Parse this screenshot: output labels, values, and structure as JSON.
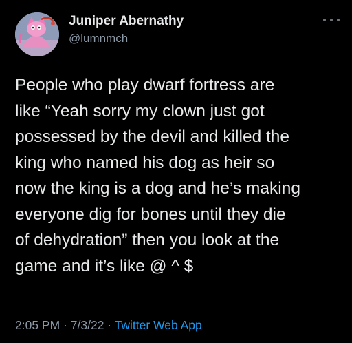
{
  "author": {
    "display_name": "Juniper Abernathy",
    "handle": "@lumnmch",
    "avatar_icon": "pink-cartoon-cat-avatar"
  },
  "more_icon": "more-horizontal-icon",
  "tweet": {
    "lines": [
      "People who play dwarf fortress are",
      "like “Yeah sorry my clown just got",
      "possessed by the devil and killed the",
      "king who named his dog as heir so",
      "now the king is a dog and he’s making",
      "everyone dig for bones until they die",
      "of dehydration” then you look at the",
      "game and it’s like @ ^ $"
    ]
  },
  "meta": {
    "time": "2:05 PM",
    "separator": "·",
    "date": "7/3/22",
    "source": "Twitter Web App"
  },
  "colors": {
    "background": "#000000",
    "text": "#e7e9ea",
    "secondary": "#8b98a5",
    "link": "#1d9bf0"
  }
}
